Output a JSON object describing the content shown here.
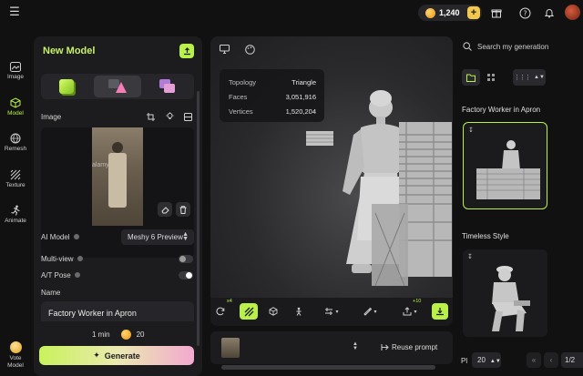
{
  "topbar": {
    "credits": "1,240",
    "menu_icon": "hamburger-icon",
    "plus": "+"
  },
  "rail": [
    {
      "label": "Image",
      "icon": "image-ai-icon"
    },
    {
      "label": "Model",
      "icon": "cube-icon",
      "active": true
    },
    {
      "label": "Remesh",
      "icon": "remesh-icon"
    },
    {
      "label": "Texture",
      "icon": "texture-icon"
    },
    {
      "label": "Animate",
      "icon": "run-icon"
    },
    {
      "label": "Vote Model",
      "icon": "vote-icon"
    }
  ],
  "panel": {
    "title": "New Model",
    "image_label": "Image",
    "ai_model_label": "AI Model",
    "ai_model_value": "Meshy 6 Preview",
    "multiview_label": "Multi-view",
    "atpose_label": "A/T Pose",
    "name_label": "Name",
    "name_value": "Factory Worker in Apron",
    "time": "1 min",
    "cost": "20",
    "generate_label": "Generate",
    "photo_watermark": "alamy"
  },
  "viewport": {
    "stats": [
      {
        "k": "Topology",
        "v": "Triangle"
      },
      {
        "k": "Faces",
        "v": "3,051,916"
      },
      {
        "k": "Vertices",
        "v": "1,520,204"
      }
    ],
    "badge_x4": "x4",
    "badge_plus10": "+10"
  },
  "prompt": {
    "reuse_label": "Reuse prompt"
  },
  "right": {
    "search_placeholder": "Search my generation",
    "items": [
      {
        "title": "Factory Worker in Apron"
      },
      {
        "title": "Timeless Style"
      }
    ],
    "page_size": "20",
    "page_label": "1/2",
    "pl": "Pl"
  }
}
